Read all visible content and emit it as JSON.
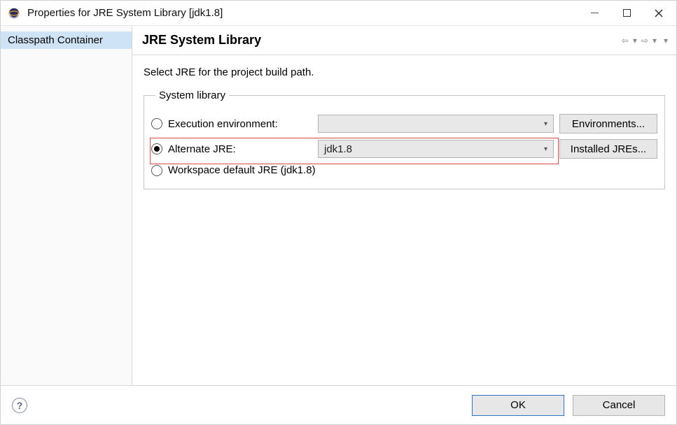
{
  "window": {
    "title": "Properties for JRE System Library [jdk1.8]"
  },
  "sidebar": {
    "items": [
      {
        "label": "Classpath Container",
        "selected": true
      }
    ]
  },
  "main": {
    "title": "JRE System Library",
    "instruction": "Select JRE for the project build path.",
    "group_legend": "System library",
    "rows": {
      "execution": {
        "label": "Execution environment:",
        "selected": false,
        "combo_value": "",
        "button": "Environments..."
      },
      "alternate": {
        "label": "Alternate JRE:",
        "selected": true,
        "combo_value": "jdk1.8",
        "button": "Installed JREs..."
      },
      "workspace": {
        "label": "Workspace default JRE (jdk1.8)",
        "selected": false
      }
    }
  },
  "footer": {
    "ok": "OK",
    "cancel": "Cancel"
  }
}
